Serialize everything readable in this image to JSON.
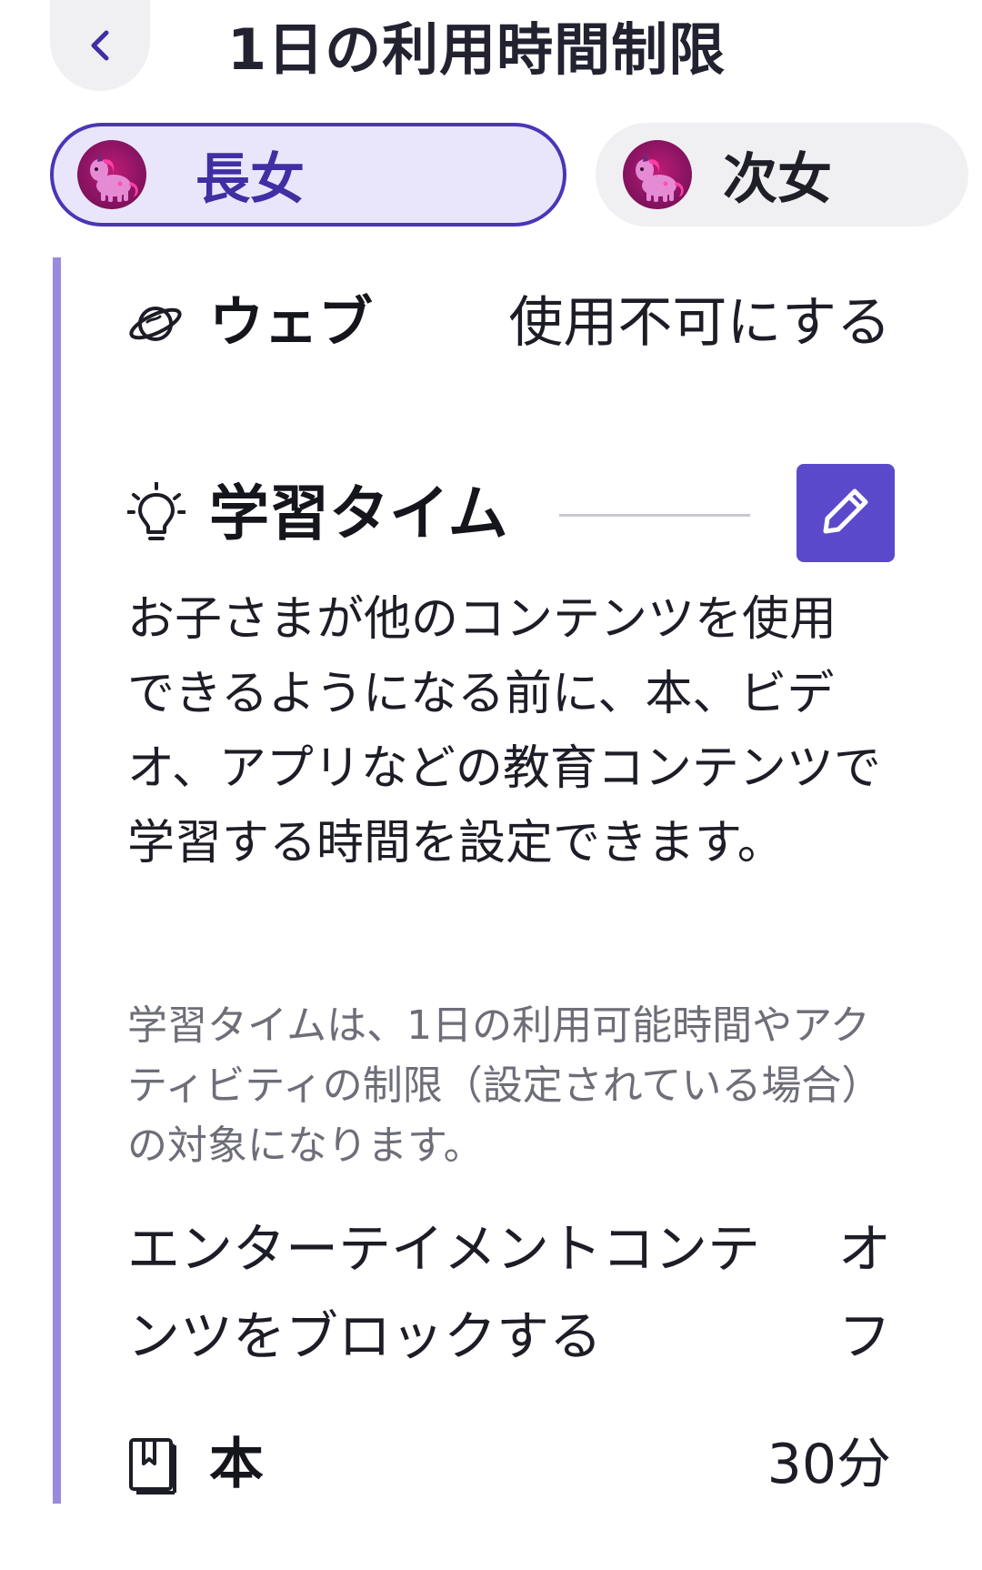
{
  "header": {
    "back_icon": "chevron-left-icon",
    "title": "1日の利用時間制限"
  },
  "profiles": [
    {
      "name": "長女",
      "avatar_icon": "unicorn-avatar",
      "selected": true
    },
    {
      "name": "次女",
      "avatar_icon": "unicorn-avatar",
      "selected": false
    }
  ],
  "web": {
    "icon": "planet-icon",
    "label": "ウェブ",
    "value": "使用不可にする"
  },
  "learning_time": {
    "icon": "lightbulb-icon",
    "title": "学習タイム",
    "edit_icon": "pencil-icon",
    "description": "お子さまが他のコンテンツを使用できるようになる前に、本、ビデオ、アプリなどの教育コンテンツで学習する時間を設定できます。",
    "note": "学習タイムは、1日の利用可能時間やアクティビティの制限（設定されている場合）の対象になります。"
  },
  "block_entertainment": {
    "label": "エンターテイメントコンテンツをブロックする",
    "value": "オフ"
  },
  "books": {
    "icon": "book-icon",
    "label": "本",
    "value": "30分"
  },
  "colors": {
    "accent": "#4b35b5",
    "accent_light": "#e9e6fb",
    "edit_button": "#5a4acb",
    "rail": "#9a89dd"
  }
}
